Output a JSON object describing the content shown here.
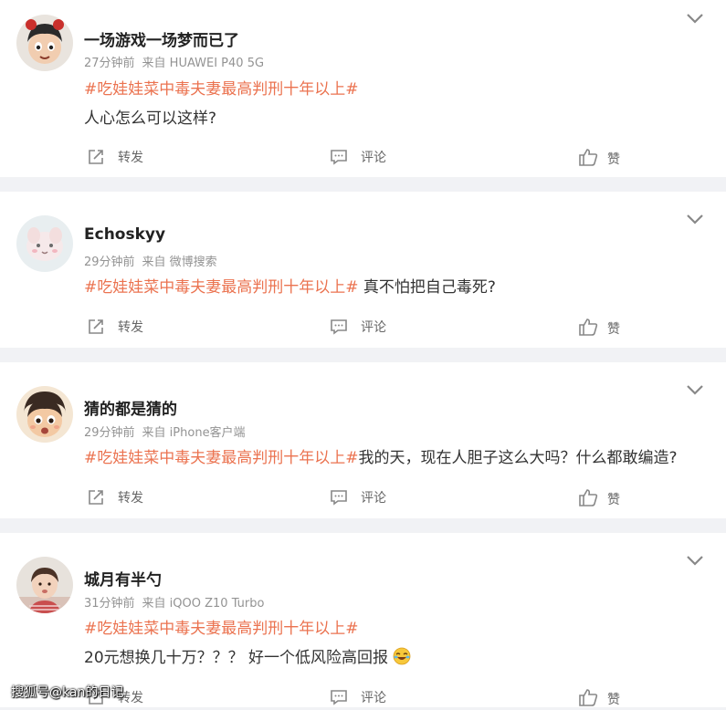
{
  "posts": [
    {
      "username": "一场游戏一场梦而已了",
      "time": "27分钟前",
      "source": "来自 HUAWEI P40 5G",
      "hashtag": "#吃娃娃菜中毒夫妻最高判刑十年以上#",
      "text": "人心怎么可以这样?"
    },
    {
      "username": "Echoskyy",
      "time": "29分钟前",
      "source": "来自 微博搜索",
      "hashtag": "#吃娃娃菜中毒夫妻最高判刑十年以上#",
      "text": " 真不怕把自己毒死?"
    },
    {
      "username": "猜的都是猜的",
      "time": "29分钟前",
      "source": "来自 iPhone客户端",
      "hashtag": "#吃娃娃菜中毒夫妻最高判刑十年以上#",
      "text": "我的天，现在人胆子这么大吗？什么都敢编造?"
    },
    {
      "username": "城月有半勺",
      "time": "31分钟前",
      "source": "来自 iQOO Z10 Turbo",
      "hashtag": "#吃娃娃菜中毒夫妻最高判刑十年以上#",
      "text": "20元想换几十万？？？  好一个低风险高回报"
    }
  ],
  "actions": {
    "repost": "转发",
    "comment": "评论",
    "like": "赞"
  },
  "watermark": "搜狐号@kan的日记",
  "icons": {
    "repost": "repost-icon",
    "comment": "comment-icon",
    "like": "thumbs-up-icon",
    "menu": "chevron-down-icon",
    "emoji": "laughing-crying-emoji-icon"
  },
  "colors": {
    "hashtag": "#eb7350",
    "background": "#f1f2f5"
  }
}
